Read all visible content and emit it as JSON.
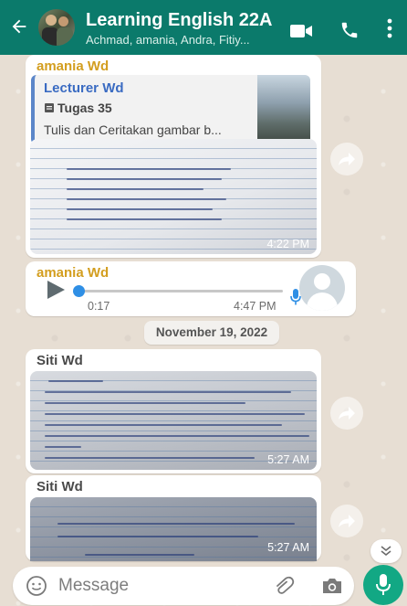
{
  "header": {
    "title": "Learning English 22A",
    "subtitle": "Achmad, amania, Andra, Fitiy..."
  },
  "messages": {
    "m1": {
      "sender": "amania Wd",
      "quote_author": "Lecturer Wd",
      "quote_title": "Tugas 35",
      "quote_text": "Tulis dan Ceritakan gambar b...",
      "time": "4:22 PM"
    },
    "m2": {
      "sender": "amania Wd",
      "duration": "0:17",
      "time": "4:47 PM",
      "progress": 0.0
    },
    "date_chip": "November 19, 2022",
    "m3": {
      "sender": "Siti Wd",
      "time": "5:27 AM"
    },
    "m4": {
      "sender": "Siti Wd",
      "time": "5:27 AM"
    }
  },
  "input": {
    "placeholder": "Message"
  },
  "colors": {
    "header": "#0b7a6b",
    "sender_amania": "#d39e1f",
    "sender_siti": "#4a4a4a",
    "accent": "#12a884",
    "voice_progress": "#2f8fe5"
  },
  "icons": [
    "back-arrow-icon",
    "video-call-icon",
    "phone-icon",
    "more-options-icon",
    "document-icon",
    "forward-icon",
    "play-icon",
    "mic-icon",
    "emoji-icon",
    "attach-icon",
    "camera-icon",
    "chevron-double-down-icon"
  ]
}
